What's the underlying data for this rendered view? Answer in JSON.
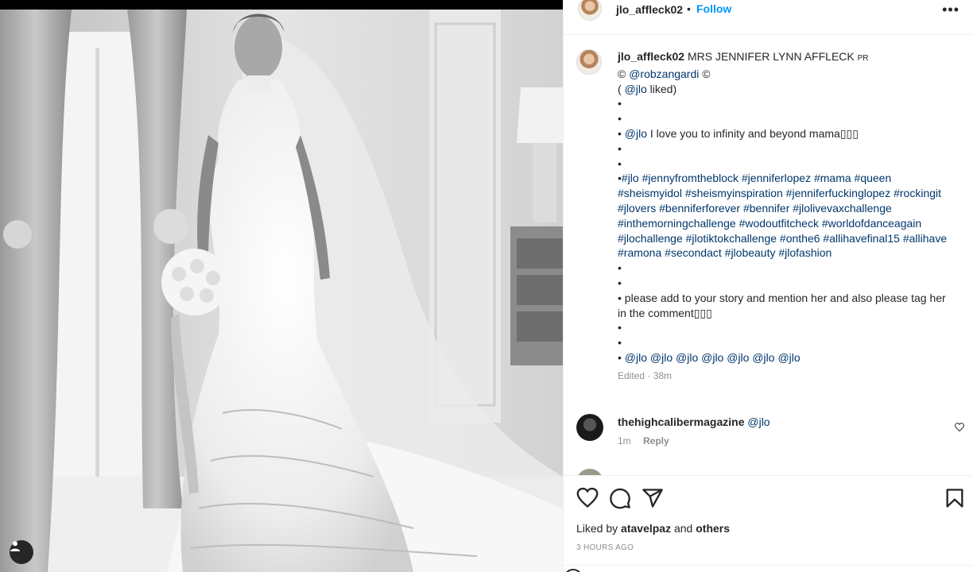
{
  "post": {
    "username": "jlo_affleck02",
    "separator": "•",
    "follow_label": "Follow",
    "more_label": "•••"
  },
  "caption": {
    "username": "jlo_affleck02",
    "title_text": " MRS JENNIFER LYNN AFFLECK ",
    "title_suffix": "PR",
    "lines": [
      "© @robzangardi ©",
      "( @jlo liked)",
      "•",
      "•",
      "• @jlo I love you to infinity and beyond mama▯▯▯",
      "•",
      "•",
      "•#jlo #jennyfromtheblock #jenniferlopez #mama #queen #sheismyidol #sheismyinspiration #jenniferfuckinglopez #rockingit #jlovers #benniferforever #bennifer #jlolivevaxchallenge #inthemorningchallenge #wodoutfitcheck #worldofdanceagain #jlochallenge #jlotiktokchallenge #onthe6 #allihavefinal15 #allihave #ramona #secondact #jlobeauty #jlofashion",
      "•",
      "•",
      "• please add to your story and mention her and also please tag her in the comment▯▯▯",
      "•",
      "•",
      "• @jlo @jlo @jlo @jlo @jlo @jlo @jlo"
    ],
    "edited": "Edited · 38m"
  },
  "comment": {
    "username": "thehighcalibermagazine",
    "text": "@jlo",
    "time": "1m",
    "reply_label": "Reply"
  },
  "footer": {
    "liked_by_prefix": "Liked by ",
    "liked_by_user": "atavelpaz",
    "liked_by_and": " and ",
    "liked_by_others": "others",
    "time_ago": "3 HOURS AGO"
  },
  "icons": [
    "like-heart-icon",
    "comment-bubble-icon",
    "share-send-icon",
    "save-bookmark-icon",
    "user-tag-icon",
    "comment-like-heart-icon"
  ],
  "colors": {
    "follow_blue": "#0095f6",
    "link_navy": "#00376b",
    "meta_gray": "#8e8e8e",
    "text_dark": "#262626"
  }
}
